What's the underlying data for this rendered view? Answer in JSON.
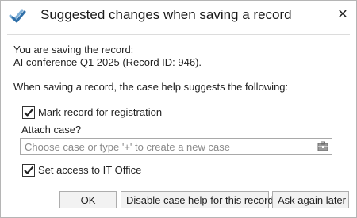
{
  "dialog": {
    "title": "Suggested changes when saving a record",
    "close_glyph": "✕"
  },
  "info": {
    "line1": "You are saving the record:",
    "line2": "AI conference Q1 2025 (Record ID: 946)."
  },
  "suggestion_intro": "When saving a record, the case help suggests the following:",
  "options": {
    "mark_registration": {
      "label": "Mark record for registration",
      "checked": true
    },
    "attach_case": {
      "label": "Attach case?",
      "placeholder": "Choose case or type '+' to create a new case",
      "icon": "case-picker-icon"
    },
    "set_access": {
      "label": "Set access to IT Office",
      "checked": true
    }
  },
  "buttons": {
    "ok": "OK",
    "disable": "Disable case help for this record",
    "ask_later": "Ask again later"
  },
  "colors": {
    "accent_check": "#5a9bd5",
    "button_bg": "#f2f2f2",
    "border": "#adadad"
  }
}
